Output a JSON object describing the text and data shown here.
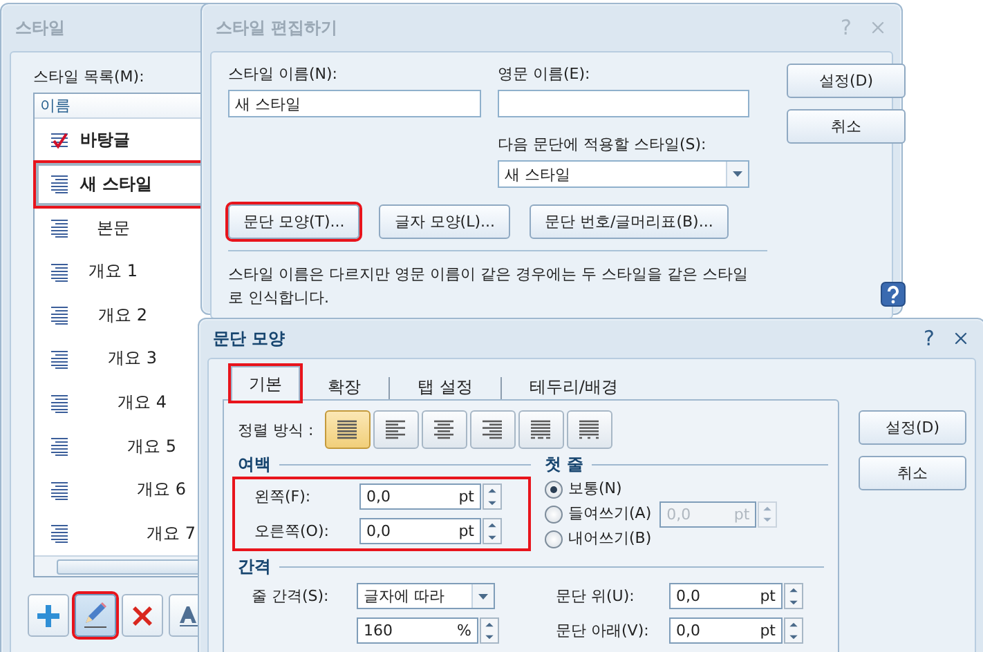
{
  "style_list_window": {
    "title": "스타일",
    "list_label": "스타일 목록(M):",
    "column_header": "이름",
    "items": [
      {
        "name": "바탕글",
        "kind": "base",
        "selected": false,
        "annotated": false
      },
      {
        "name": "새 스타일",
        "kind": "custom",
        "selected": true,
        "annotated": true
      },
      {
        "name": "본문",
        "kind": "body",
        "selected": false,
        "annotated": false
      },
      {
        "name": "개요 1",
        "kind": "outline",
        "selected": false,
        "annotated": false
      },
      {
        "name": "개요 2",
        "kind": "outline",
        "selected": false,
        "annotated": false
      },
      {
        "name": "개요 3",
        "kind": "outline",
        "selected": false,
        "annotated": false
      },
      {
        "name": "개요 4",
        "kind": "outline",
        "selected": false,
        "annotated": false
      },
      {
        "name": "개요 5",
        "kind": "outline",
        "selected": false,
        "annotated": false
      },
      {
        "name": "개요 6",
        "kind": "outline",
        "selected": false,
        "annotated": false
      },
      {
        "name": "개요 7",
        "kind": "outline",
        "selected": false,
        "annotated": false
      }
    ],
    "tools": [
      {
        "kind": "add",
        "pressed": false,
        "annotated": false
      },
      {
        "kind": "edit",
        "pressed": true,
        "annotated": true
      },
      {
        "kind": "delete",
        "pressed": false,
        "annotated": false
      },
      {
        "kind": "font",
        "pressed": false,
        "annotated": false
      }
    ]
  },
  "edit_style_window": {
    "title": "스타일 편집하기",
    "help": "?",
    "style_name": {
      "label": "스타일 이름(N):",
      "value": "새 스타일"
    },
    "english_name": {
      "label": "영문 이름(E):"
    },
    "next_style": {
      "label": "다음 문단에 적용할 스타일(S):",
      "value": "새 스타일"
    },
    "buttons": [
      "설정(D)",
      "취소"
    ],
    "actions": [
      {
        "label": "문단 모양(T)...",
        "annotated": true
      },
      {
        "label": "글자 모양(L)...",
        "annotated": false
      },
      {
        "label": "문단 번호/글머리표(B)...",
        "annotated": false
      }
    ],
    "note": "스타일 이름은 다르지만 영문 이름이 같은 경우에는 두 스타일을 같은 스타일로 인식합니다."
  },
  "paragraph_window": {
    "title": "문단 모양",
    "help": "?",
    "tabs": [
      {
        "label": "기본",
        "selected": true,
        "annotated": true
      },
      {
        "label": "확장",
        "selected": false,
        "annotated": false
      },
      {
        "label": "탭 설정",
        "selected": false,
        "annotated": false
      },
      {
        "label": "테두리/배경",
        "selected": false,
        "annotated": false
      }
    ],
    "buttons": [
      "설정(D)",
      "취소"
    ],
    "alignment": {
      "label": "정렬 방식 :",
      "options": [
        {
          "kind": "justify",
          "selected": true
        },
        {
          "kind": "left",
          "selected": false
        },
        {
          "kind": "center",
          "selected": false
        },
        {
          "kind": "right",
          "selected": false
        },
        {
          "kind": "distribute",
          "selected": false
        },
        {
          "kind": "divide",
          "selected": false
        }
      ]
    },
    "margin": {
      "title": "여백",
      "annotated": true,
      "fields": [
        {
          "label": "왼쪽(F):",
          "value": "0,0",
          "unit": "pt"
        },
        {
          "label": "오른쪽(O):",
          "value": "0,0",
          "unit": "pt"
        }
      ]
    },
    "first_line": {
      "title": "첫 줄",
      "options": [
        {
          "label": "보통(N)",
          "selected": true
        },
        {
          "label": "들여쓰기(A)",
          "selected": false
        },
        {
          "label": "내어쓰기(B)",
          "selected": false
        }
      ],
      "amount": {
        "value": "0,0",
        "unit": "pt",
        "disabled": true
      }
    },
    "spacing": {
      "title": "간격",
      "line_spacing": {
        "label": "줄 간격(S):",
        "value": "글자에 따라"
      },
      "line_spacing_value": {
        "value": "160",
        "unit": "%"
      },
      "above": {
        "label": "문단 위(U):",
        "value": "0,0",
        "unit": "pt"
      },
      "below": {
        "label": "문단 아래(V):",
        "value": "0,0",
        "unit": "pt"
      }
    }
  }
}
